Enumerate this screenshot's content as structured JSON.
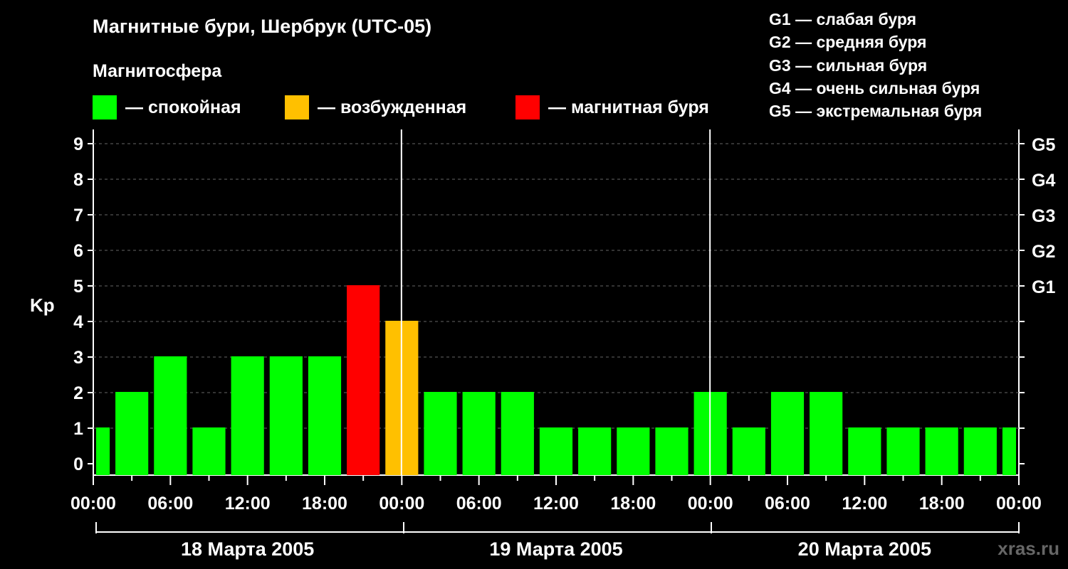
{
  "title": "Магнитные бури, Шербрук (UTC-05)",
  "subtitle": "Магнитосфера",
  "legend": [
    {
      "label": "— спокойная",
      "color": "#00ff00"
    },
    {
      "label": "— возбужденная",
      "color": "#ffc000"
    },
    {
      "label": "— магнитная буря",
      "color": "#ff0000"
    }
  ],
  "g_scale": [
    "G1 — слабая буря",
    "G2 — средняя буря",
    "G3 — сильная буря",
    "G4 — очень сильная буря",
    "G5 — экстремальная буря"
  ],
  "watermark": "xras.ru",
  "chart_data": {
    "type": "bar",
    "ylabel": "Kp",
    "ylim": [
      0,
      9
    ],
    "yticks": [
      "0",
      "1",
      "2",
      "3",
      "4",
      "5",
      "6",
      "7",
      "8",
      "9"
    ],
    "right_ticks": [
      {
        "value": 5,
        "label": "G1"
      },
      {
        "value": 6,
        "label": "G2"
      },
      {
        "value": 7,
        "label": "G3"
      },
      {
        "value": 8,
        "label": "G4"
      },
      {
        "value": 9,
        "label": "G5"
      }
    ],
    "grid": true,
    "x_tick_labels": [
      "00:00",
      "06:00",
      "12:00",
      "18:00",
      "00:00",
      "06:00",
      "12:00",
      "18:00",
      "00:00",
      "06:00",
      "12:00",
      "18:00",
      "00:00"
    ],
    "days": [
      "18 Марта 2005",
      "19 Марта 2005",
      "20 Марта 2005"
    ],
    "colors": {
      "quiet": "#00ff00",
      "active": "#ffc000",
      "storm": "#ff0000"
    },
    "series": [
      {
        "values": [
          1,
          2,
          3,
          1,
          3,
          3,
          3,
          5,
          4,
          2,
          2,
          2,
          1,
          1,
          1,
          1,
          2,
          1,
          2,
          2,
          1,
          1,
          1,
          1,
          1
        ],
        "levels": [
          "quiet",
          "quiet",
          "quiet",
          "quiet",
          "quiet",
          "quiet",
          "quiet",
          "storm",
          "active",
          "quiet",
          "quiet",
          "quiet",
          "quiet",
          "quiet",
          "quiet",
          "quiet",
          "quiet",
          "quiet",
          "quiet",
          "quiet",
          "quiet",
          "quiet",
          "quiet",
          "quiet",
          "quiet"
        ]
      }
    ]
  }
}
